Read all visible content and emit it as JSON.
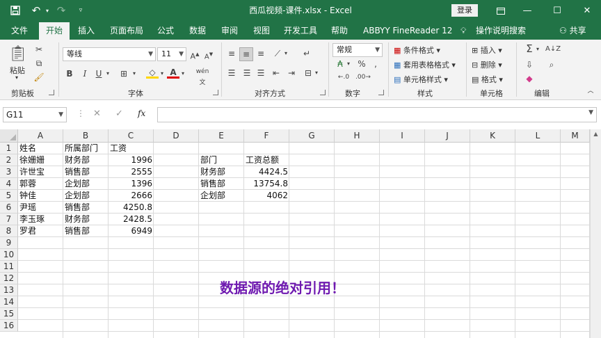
{
  "window": {
    "title": "西瓜视频-课件.xlsx  -  Excel",
    "login": "登录"
  },
  "tabs": [
    "文件",
    "开始",
    "插入",
    "页面布局",
    "公式",
    "数据",
    "审阅",
    "视图",
    "开发工具",
    "帮助",
    "ABBYY FineReader 12",
    "操作说明搜索",
    "共享"
  ],
  "ribbon": {
    "paste": "粘贴",
    "font_name": "等线",
    "font_size": "11",
    "number_format": "常规",
    "cond_format": "条件格式",
    "table_format": "套用表格格式",
    "cell_style": "单元格样式",
    "insert": "插入",
    "delete": "删除",
    "format": "格式",
    "groups": {
      "clipboard": "剪贴板",
      "font": "字体",
      "alignment": "对齐方式",
      "number": "数字",
      "style": "样式",
      "cells": "单元格",
      "editing": "编辑"
    },
    "accent_color": "#217346"
  },
  "formula_bar": {
    "name_box": "G11",
    "formula": ""
  },
  "sheet": {
    "columns": [
      "A",
      "B",
      "C",
      "D",
      "E",
      "F",
      "G",
      "H",
      "I",
      "J",
      "K",
      "L",
      "M"
    ],
    "rows": [
      "1",
      "2",
      "3",
      "4",
      "5",
      "6",
      "7",
      "8",
      "9",
      "10",
      "11",
      "12",
      "13",
      "14",
      "15",
      "16"
    ],
    "table1": {
      "headers": [
        "姓名",
        "所属部门",
        "工资"
      ],
      "rows": [
        [
          "徐姗姗",
          "财务部",
          "1996"
        ],
        [
          "许世宝",
          "销售部",
          "2555"
        ],
        [
          "郭蓉",
          "企划部",
          "1396"
        ],
        [
          "钟佳",
          "企划部",
          "2666"
        ],
        [
          "尹瑶",
          "销售部",
          "4250.8"
        ],
        [
          "李玉琢",
          "财务部",
          "2428.5"
        ],
        [
          "罗君",
          "销售部",
          "6949"
        ]
      ]
    },
    "table2": {
      "headers": [
        "部门",
        "工资总额"
      ],
      "rows": [
        [
          "财务部",
          "4424.5"
        ],
        [
          "销售部",
          "13754.8"
        ],
        [
          "企划部",
          "4062"
        ]
      ]
    }
  },
  "annotation": "数据源的绝对引用！",
  "annotation_color": "#6f1ab0"
}
